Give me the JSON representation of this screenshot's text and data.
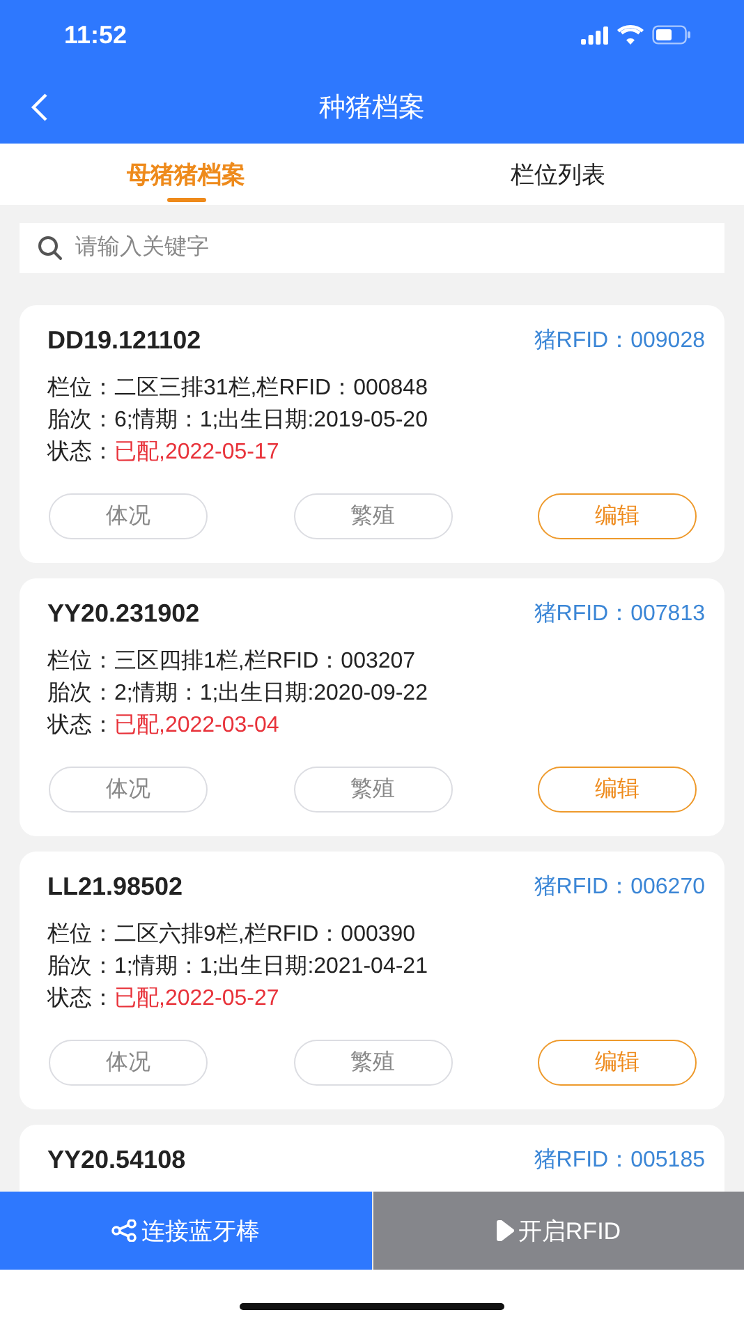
{
  "status_bar": {
    "time": "11:52"
  },
  "nav": {
    "title": "种猪档案"
  },
  "tabs": [
    {
      "label": "母猪猪档案",
      "selected": true
    },
    {
      "label": "栏位列表",
      "selected": false
    }
  ],
  "search": {
    "placeholder": "请输入关键字"
  },
  "cards": [
    {
      "id": "DD19.121102",
      "rfid": "猪RFID：009028",
      "lines": [
        "栏位：二区三排31栏,栏RFID：000848",
        "胎次：6;情期：1;出生日期:2019-05-20"
      ],
      "status_label": "状态：",
      "status": "已配,2022-05-17",
      "buttons": [
        {
          "label": "体况",
          "kind": "plain"
        },
        {
          "label": "繁殖",
          "kind": "plain"
        },
        {
          "label": "编辑",
          "kind": "accent"
        }
      ]
    },
    {
      "id": "YY20.231902",
      "rfid": "猪RFID：007813",
      "lines": [
        "栏位：三区四排1栏,栏RFID：003207",
        "胎次：2;情期：1;出生日期:2020-09-22"
      ],
      "status_label": "状态：",
      "status": "已配,2022-03-04",
      "buttons": [
        {
          "label": "体况",
          "kind": "plain"
        },
        {
          "label": "繁殖",
          "kind": "plain"
        },
        {
          "label": "编辑",
          "kind": "accent"
        }
      ]
    },
    {
      "id": "LL21.98502",
      "rfid": "猪RFID：006270",
      "lines": [
        "栏位：二区六排9栏,栏RFID：000390",
        "胎次：1;情期：1;出生日期:2021-04-21"
      ],
      "status_label": "状态：",
      "status": "已配,2022-05-27",
      "buttons": [
        {
          "label": "体况",
          "kind": "plain"
        },
        {
          "label": "繁殖",
          "kind": "plain"
        },
        {
          "label": "编辑",
          "kind": "accent"
        }
      ]
    },
    {
      "id": "YY20.54108",
      "rfid": "猪RFID：005185"
    }
  ],
  "bottom_buttons": [
    {
      "label": "连接蓝牙棒",
      "kind": "share"
    },
    {
      "label": "开启RFID",
      "kind": "play"
    }
  ]
}
